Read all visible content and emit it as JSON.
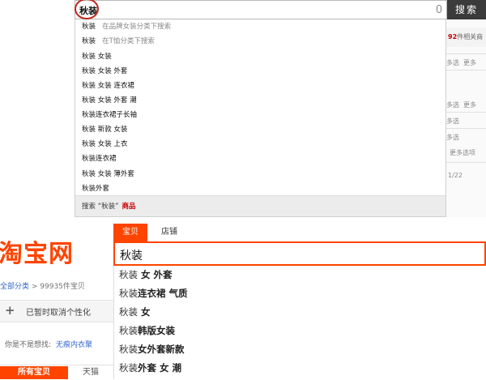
{
  "top": {
    "query": "秋装",
    "search_button": "搜索",
    "suggestions": [
      {
        "keyword": "秋装",
        "scope": "在品牌女装分类下搜索"
      },
      {
        "keyword": "秋装",
        "scope": "在T恤分类下搜索"
      },
      {
        "keyword": "秋装 女装",
        "scope": ""
      },
      {
        "keyword": "秋装 女装 外套",
        "scope": ""
      },
      {
        "keyword": "秋装 女装 连衣裙",
        "scope": ""
      },
      {
        "keyword": "秋装 女装 外套 潮",
        "scope": ""
      },
      {
        "keyword": "秋装连衣裙子长袖",
        "scope": ""
      },
      {
        "keyword": "秋装 新款 女装",
        "scope": ""
      },
      {
        "keyword": "秋装 女装 上衣",
        "scope": ""
      },
      {
        "keyword": "秋装连衣裙",
        "scope": ""
      },
      {
        "keyword": "秋装 女装 薄外套",
        "scope": ""
      },
      {
        "keyword": "秋装外套",
        "scope": ""
      }
    ],
    "footer": {
      "prefix": "搜索",
      "quoted": "“秋装”",
      "suffix": "商品"
    },
    "right": {
      "result_count": "92",
      "result_suffix": "件相关商",
      "rows": [
        "多选",
        "更多",
        "多选",
        "更多",
        "多选",
        "多选",
        "更多选项",
        "1/22"
      ]
    }
  },
  "bottom": {
    "logo": "淘宝网",
    "breadcrumb_all": "全部分类",
    "breadcrumb_count": "99935件宝贝",
    "personalize": "已暂时取消个性化",
    "hint_label": "你是不是想找:",
    "hint_link": "无痕内衣聚",
    "tab_all": "所有宝贝",
    "tab_tmall": "天猫",
    "search_tabs": [
      "宝贝",
      "店铺"
    ],
    "query": "秋装",
    "suggestions": [
      {
        "base": "秋装",
        "rest": " 女 外套"
      },
      {
        "base": "秋装",
        "rest": "连衣裙 气质"
      },
      {
        "base": "秋装",
        "rest": " 女"
      },
      {
        "base": "秋装",
        "rest": "韩版女装"
      },
      {
        "base": "秋装",
        "rest": "女外套新款"
      },
      {
        "base": "秋装",
        "rest": "外套 女 潮"
      }
    ]
  },
  "colors": {
    "taobao_orange": "#ff4400",
    "highlight_red": "#c40000"
  }
}
